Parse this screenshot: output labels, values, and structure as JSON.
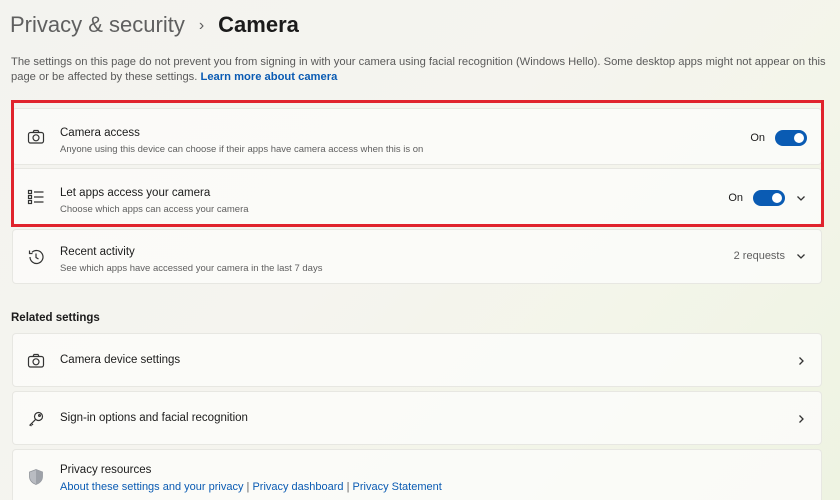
{
  "header": {
    "parent": "Privacy & security",
    "separator": "›",
    "current": "Camera"
  },
  "description": {
    "text": "The settings on this page do not prevent you from signing in with your camera using facial recognition (Windows Hello). Some desktop apps might not appear on this page or be affected by these settings.",
    "link": "Learn more about camera"
  },
  "settings": {
    "camera_access": {
      "title": "Camera access",
      "subtitle": "Anyone using this device can choose if their apps have camera access when this is on",
      "state": "On",
      "icon": "camera-icon"
    },
    "apps_access": {
      "title": "Let apps access your camera",
      "subtitle": "Choose which apps can access your camera",
      "state": "On",
      "icon": "app-list-icon"
    },
    "recent_activity": {
      "title": "Recent activity",
      "subtitle": "See which apps have accessed your camera in the last 7 days",
      "value": "2 requests",
      "icon": "history-icon"
    }
  },
  "related": {
    "heading": "Related settings",
    "camera_device": {
      "title": "Camera device settings",
      "icon": "camera-icon"
    },
    "sign_in": {
      "title": "Sign-in options and facial recognition",
      "icon": "key-icon"
    },
    "privacy_resources": {
      "title": "Privacy resources",
      "icon": "shield-icon",
      "link1": "About these settings and your privacy",
      "sep": "|",
      "link2": "Privacy dashboard",
      "link3": "Privacy Statement"
    }
  },
  "colors": {
    "accent": "#0a5bb3",
    "highlight": "#e0232d"
  }
}
